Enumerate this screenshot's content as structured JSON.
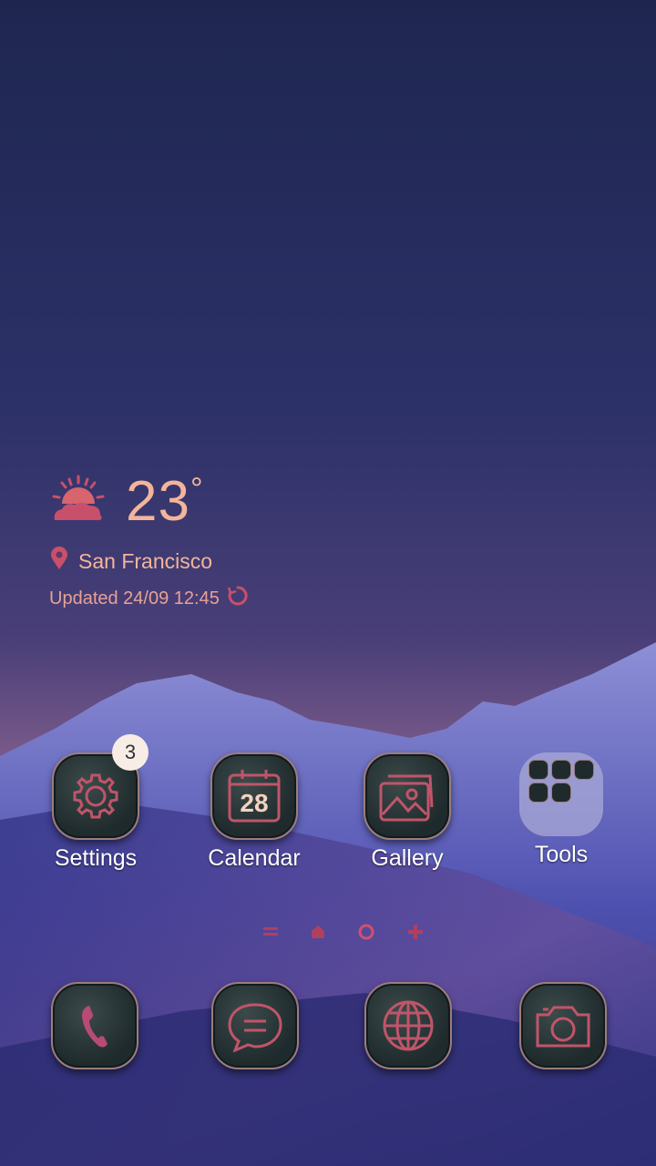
{
  "weather": {
    "temperature": "23",
    "degree": "°",
    "location": "San Francisco",
    "updated": "Updated 24/09 12:45",
    "icon": "sun-cloud-icon"
  },
  "apps": [
    {
      "label": "Settings",
      "icon": "gear-icon",
      "badge": "3"
    },
    {
      "label": "Calendar",
      "icon": "calendar-icon",
      "day": "28"
    },
    {
      "label": "Gallery",
      "icon": "gallery-icon"
    },
    {
      "label": "Tools",
      "icon": "folder-icon"
    }
  ],
  "dock": [
    {
      "icon": "phone-icon"
    },
    {
      "icon": "messages-icon"
    },
    {
      "icon": "browser-globe-icon"
    },
    {
      "icon": "camera-icon"
    }
  ],
  "colors": {
    "accent": "#f3b59a",
    "icon_stroke": "#c0556a",
    "tile": "#1e2a2c"
  }
}
